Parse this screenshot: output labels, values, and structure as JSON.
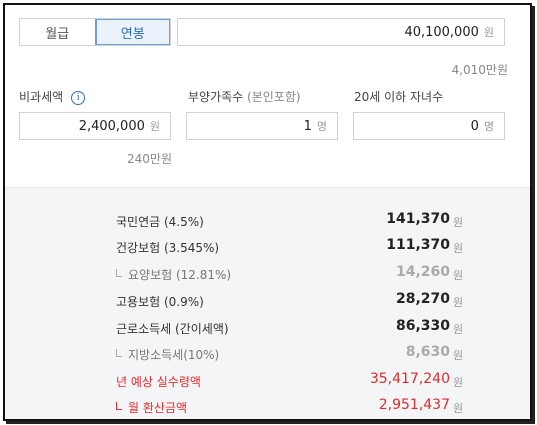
{
  "tabs": {
    "monthly": "월급",
    "annual": "연봉",
    "selected": "연봉"
  },
  "salary": {
    "value": "40,100,000",
    "unit": "원",
    "hint": "4,010만원"
  },
  "nontax": {
    "label": "비과세액",
    "value": "2,400,000",
    "unit": "원",
    "hint": "240만원"
  },
  "dependents": {
    "label": "부양가족수",
    "label_note": "(본인포함)",
    "value": "1",
    "unit": "명"
  },
  "children": {
    "label": "20세 이하 자녀수",
    "value": "0",
    "unit": "명"
  },
  "results": [
    {
      "name": "국민연금 (4.5%)",
      "amount": "141,370",
      "unit": "원",
      "kind": "main"
    },
    {
      "name": "건강보험 (3.545%)",
      "amount": "111,370",
      "unit": "원",
      "kind": "main"
    },
    {
      "name": "요양보험 (12.81%)",
      "amount": "14,260",
      "unit": "원",
      "kind": "sub"
    },
    {
      "name": "고용보험 (0.9%)",
      "amount": "28,270",
      "unit": "원",
      "kind": "main"
    },
    {
      "name": "근로소득세 (간이세액)",
      "amount": "86,330",
      "unit": "원",
      "kind": "main"
    },
    {
      "name": "지방소득세(10%)",
      "amount": "8,630",
      "unit": "원",
      "kind": "sub"
    },
    {
      "name": "년 예상 실수령액",
      "amount": "35,417,240",
      "unit": "원",
      "kind": "red"
    },
    {
      "name": "월 환산금액",
      "amount": "2,951,437",
      "unit": "원",
      "kind": "redsub"
    }
  ],
  "colors": {
    "accent": "#2d6fb5",
    "highlight": "#e02b2b",
    "panel_bg": "#f4f5f7"
  }
}
